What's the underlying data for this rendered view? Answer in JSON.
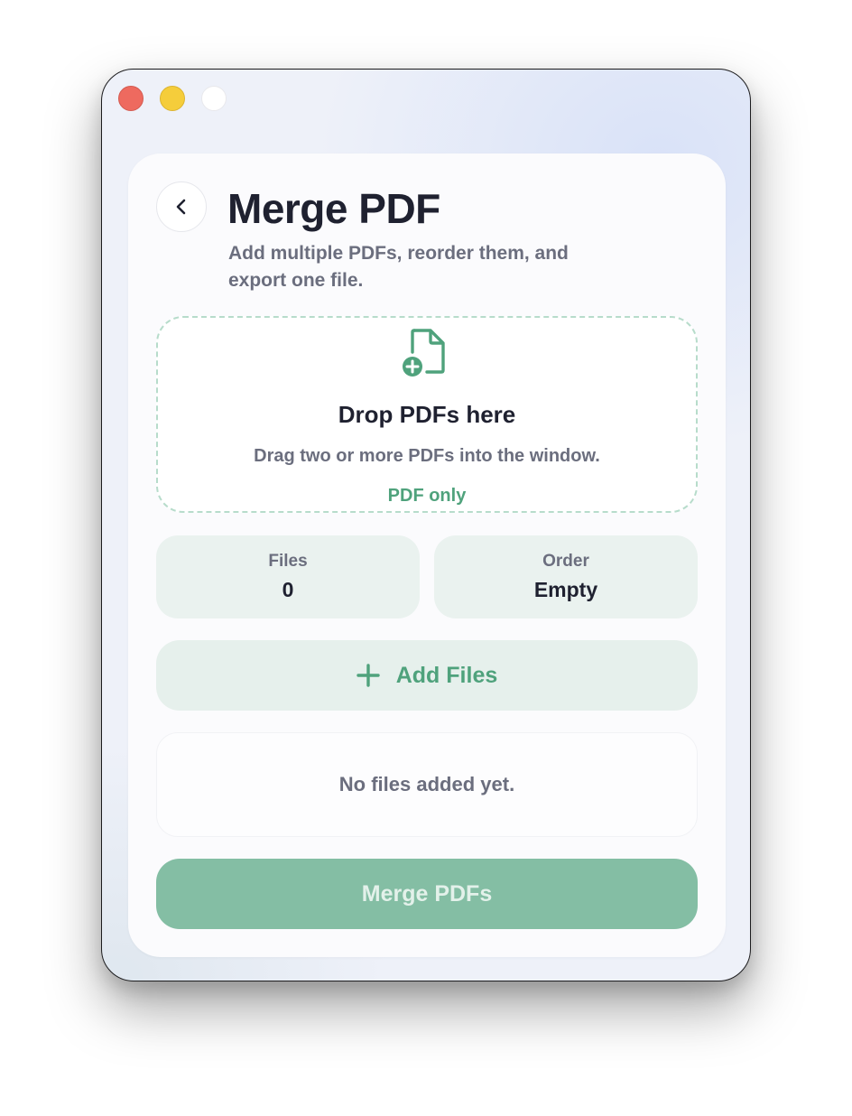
{
  "window": {
    "controls": [
      "close",
      "minimize",
      "zoom"
    ]
  },
  "header": {
    "title": "Merge PDF",
    "subtitle": "Add multiple PDFs, reorder them, and export one file.",
    "back_icon": "chevron-left-icon"
  },
  "dropzone": {
    "icon": "document-plus-icon",
    "title": "Drop PDFs here",
    "description": "Drag two or more PDFs into the window.",
    "badge": "PDF only"
  },
  "stats": {
    "files": {
      "label": "Files",
      "value": "0"
    },
    "order": {
      "label": "Order",
      "value": "Empty"
    }
  },
  "add_button": {
    "icon": "plus-icon",
    "label": "Add Files"
  },
  "file_list": {
    "empty_text": "No files added yet."
  },
  "merge_button": {
    "label": "Merge PDFs",
    "enabled": false
  },
  "colors": {
    "accent": "#4fa27c",
    "accent_disabled": "#84bea4",
    "text_primary": "#1f2130",
    "text_secondary": "#6b6e7e",
    "tile_background": "#eaf2ef",
    "close": "#ee6a5f",
    "minimize": "#f5cd3b"
  }
}
